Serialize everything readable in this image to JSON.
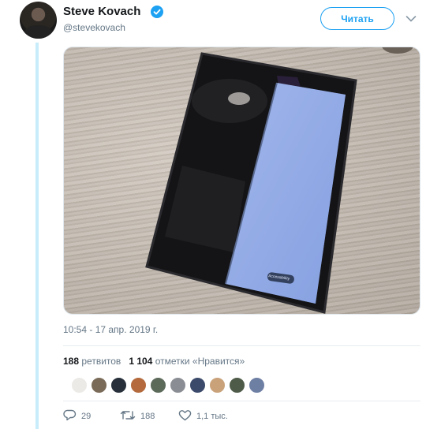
{
  "author": {
    "name": "Steve Kovach",
    "handle": "@stevekovach",
    "verified": true
  },
  "follow_button": {
    "label": "Читать"
  },
  "photo": {
    "screen_label": "Accessibility"
  },
  "timestamp": "10:54 - 17 апр. 2019 г.",
  "stats": {
    "retweets_count": "188",
    "retweets_label": "ретвитов",
    "likes_count": "1 104",
    "likes_label": "отметки «Нравится»"
  },
  "actions": {
    "replies": "29",
    "retweets": "188",
    "likes": "1,1 тыс."
  },
  "colors": {
    "accent": "#1da1f2",
    "thread_line": "#c9ecfb",
    "secondary_text": "#657786"
  },
  "icons": [
    "verified-badge-icon",
    "chevron-down-icon",
    "reply-icon",
    "retweet-icon",
    "like-icon"
  ]
}
